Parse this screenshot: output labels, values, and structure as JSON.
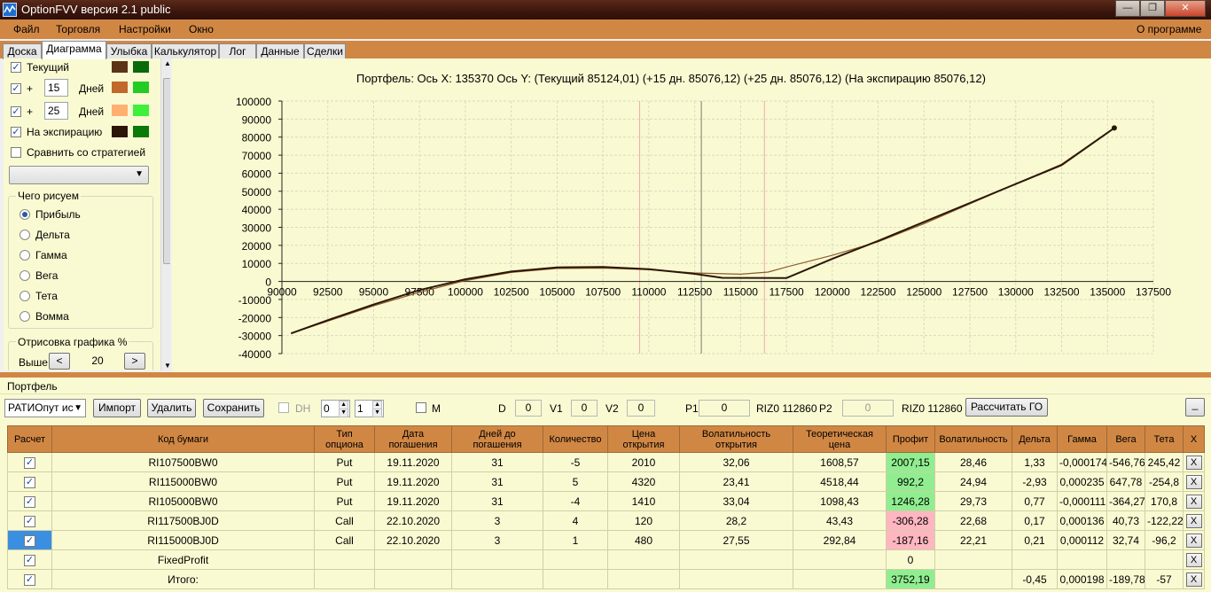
{
  "window": {
    "title": "OptionFVV версия 2.1 public"
  },
  "menu": {
    "items": [
      "Файл",
      "Торговля",
      "Настройки",
      "Окно"
    ],
    "about": "О программе"
  },
  "tabs": [
    {
      "label": "Доска"
    },
    {
      "label": "Диаграмма",
      "active": true
    },
    {
      "label": "Улыбка"
    },
    {
      "label": "Калькулятор"
    },
    {
      "label": "Лог"
    },
    {
      "label": "Данные"
    },
    {
      "label": "Сделки"
    }
  ],
  "left": {
    "current_label": "Текущий",
    "plus": "+",
    "days_label": "Дней",
    "days1": "15",
    "days2": "25",
    "expiry_label": "На экспирацию",
    "compare_label": "Сравнить со стратегией",
    "group_title": "Чего рисуем",
    "radios": [
      "Прибыль",
      "Дельта",
      "Гамма",
      "Вега",
      "Тета",
      "Вомма"
    ],
    "draw_title": "Отрисовка графика %",
    "above_label": "Выше",
    "above_value": "20",
    "colors": {
      "current": [
        "#5c3317",
        "#0a6a0a"
      ],
      "d15": [
        "#c0692a",
        "#22cc22"
      ],
      "d25": [
        "#ffb070",
        "#3cf03c"
      ],
      "expiry": [
        "#2b1608",
        "#0a7a0a"
      ]
    }
  },
  "chart_data": {
    "type": "line",
    "title": "Портфель: Ось X:  135370 Ось Y:  (Текущий 85124,01)  (+15 дн. 85076,12)  (+25 дн. 85076,12)  (На экспирацию 85076,12)",
    "x_ticks": [
      90000,
      92500,
      95000,
      97500,
      100000,
      102500,
      105000,
      107500,
      110000,
      112500,
      115000,
      117500,
      120000,
      122500,
      125000,
      127500,
      130000,
      132500,
      135000,
      137500
    ],
    "y_ticks": [
      100000,
      90000,
      80000,
      70000,
      60000,
      50000,
      40000,
      30000,
      20000,
      10000,
      0,
      -10000,
      -20000,
      -30000,
      -40000
    ],
    "xlim": [
      90000,
      137500
    ],
    "ylim": [
      -40000,
      100000
    ],
    "grid": true,
    "series": [
      {
        "color": "#8b5a2b",
        "points": [
          [
            90500,
            -28800
          ],
          [
            92500,
            -22000
          ],
          [
            95000,
            -13500
          ],
          [
            97500,
            -6000
          ],
          [
            100000,
            500
          ],
          [
            102500,
            5000
          ],
          [
            105000,
            7200
          ],
          [
            107500,
            7400
          ],
          [
            110000,
            6500
          ],
          [
            112500,
            4700
          ],
          [
            115000,
            4000
          ],
          [
            116500,
            5200
          ],
          [
            117500,
            8000
          ],
          [
            120000,
            14500
          ],
          [
            122500,
            22000
          ],
          [
            125000,
            32000
          ],
          [
            127500,
            43000
          ],
          [
            130000,
            54000
          ],
          [
            132500,
            65000
          ],
          [
            135370,
            85124
          ]
        ]
      },
      {
        "color": "#2b1608",
        "points": [
          [
            90500,
            -28800
          ],
          [
            92500,
            -21500
          ],
          [
            95000,
            -12800
          ],
          [
            97500,
            -4800
          ],
          [
            100000,
            1200
          ],
          [
            102500,
            5500
          ],
          [
            105000,
            7800
          ],
          [
            107500,
            8000
          ],
          [
            110000,
            6800
          ],
          [
            112500,
            4200
          ],
          [
            114000,
            2000
          ],
          [
            117500,
            1900
          ],
          [
            120000,
            12500
          ],
          [
            122500,
            22500
          ],
          [
            125000,
            33000
          ],
          [
            127500,
            43500
          ],
          [
            130000,
            54000
          ],
          [
            132500,
            64500
          ],
          [
            135370,
            85076
          ]
        ]
      }
    ],
    "vlines": [
      {
        "x": 109500,
        "color": "#f0a8a8"
      },
      {
        "x": 112860,
        "color": "#777777"
      },
      {
        "x": 116300,
        "color": "#f0a8a8"
      }
    ]
  },
  "portfolio": {
    "title": "Портфель",
    "strategy": "РАТИОпут исп",
    "import_btn": "Импорт",
    "delete_btn": "Удалить",
    "save_btn": "Сохранить",
    "dh_label": "DH",
    "spin1": "0",
    "spin2": "1",
    "m_label": "M",
    "d_label": "D",
    "d_value": "0",
    "v1_label": "V1",
    "v1_value": "0",
    "v2_label": "V2",
    "v2_value": "0",
    "p1_label": "P1",
    "p1_value": "0",
    "p1_ticker": "RIZ0 112860",
    "p2_label": "P2",
    "p2_value": "0",
    "p2_ticker": "RIZ0 112860",
    "calc_btn": "Рассчитать ГО",
    "minimize_btn": "_",
    "columns": [
      "Расчет",
      "Код бумаги",
      "Тип опциона",
      "Дата погашения",
      "Дней до погашения",
      "Количество",
      "Цена открытия",
      "Волатильность открытия",
      "Теоретическая цена",
      "Профит",
      "Волатильность",
      "Дельта",
      "Гамма",
      "Вега",
      "Тета",
      "X"
    ],
    "rows": [
      [
        "RI107500BW0",
        "Put",
        "19.11.2020",
        "31",
        "-5",
        "2010",
        "32,06",
        "1608,57",
        "2007,15",
        "28,46",
        "1,33",
        "-0,000174",
        "-546,76",
        "245,42"
      ],
      [
        "RI115000BW0",
        "Put",
        "19.11.2020",
        "31",
        "5",
        "4320",
        "23,41",
        "4518,44",
        "992,2",
        "24,94",
        "-2,93",
        "0,000235",
        "647,78",
        "-254,8"
      ],
      [
        "RI105000BW0",
        "Put",
        "19.11.2020",
        "31",
        "-4",
        "1410",
        "33,04",
        "1098,43",
        "1246,28",
        "29,73",
        "0,77",
        "-0,000111",
        "-364,27",
        "170,8"
      ],
      [
        "RI117500BJ0D",
        "Call",
        "22.10.2020",
        "3",
        "4",
        "120",
        "28,2",
        "43,43",
        "-306,28",
        "22,68",
        "0,17",
        "0,000136",
        "40,73",
        "-122,22"
      ],
      [
        "RI115000BJ0D",
        "Call",
        "22.10.2020",
        "3",
        "1",
        "480",
        "27,55",
        "292,84",
        "-187,16",
        "22,21",
        "0,21",
        "0,000112",
        "32,74",
        "-96,2"
      ]
    ],
    "row_profit_sign": [
      "pos",
      "pos",
      "pos",
      "neg",
      "neg"
    ],
    "fixed_row": {
      "code": "FixedProfit",
      "profit": "0"
    },
    "total_row": {
      "code": "Итого:",
      "profit": "3752,19",
      "delta": "-0,45",
      "gamma": "0,000198",
      "vega": "-189,78",
      "theta": "-57"
    },
    "x_label": "X",
    "check_mark": "✓"
  }
}
